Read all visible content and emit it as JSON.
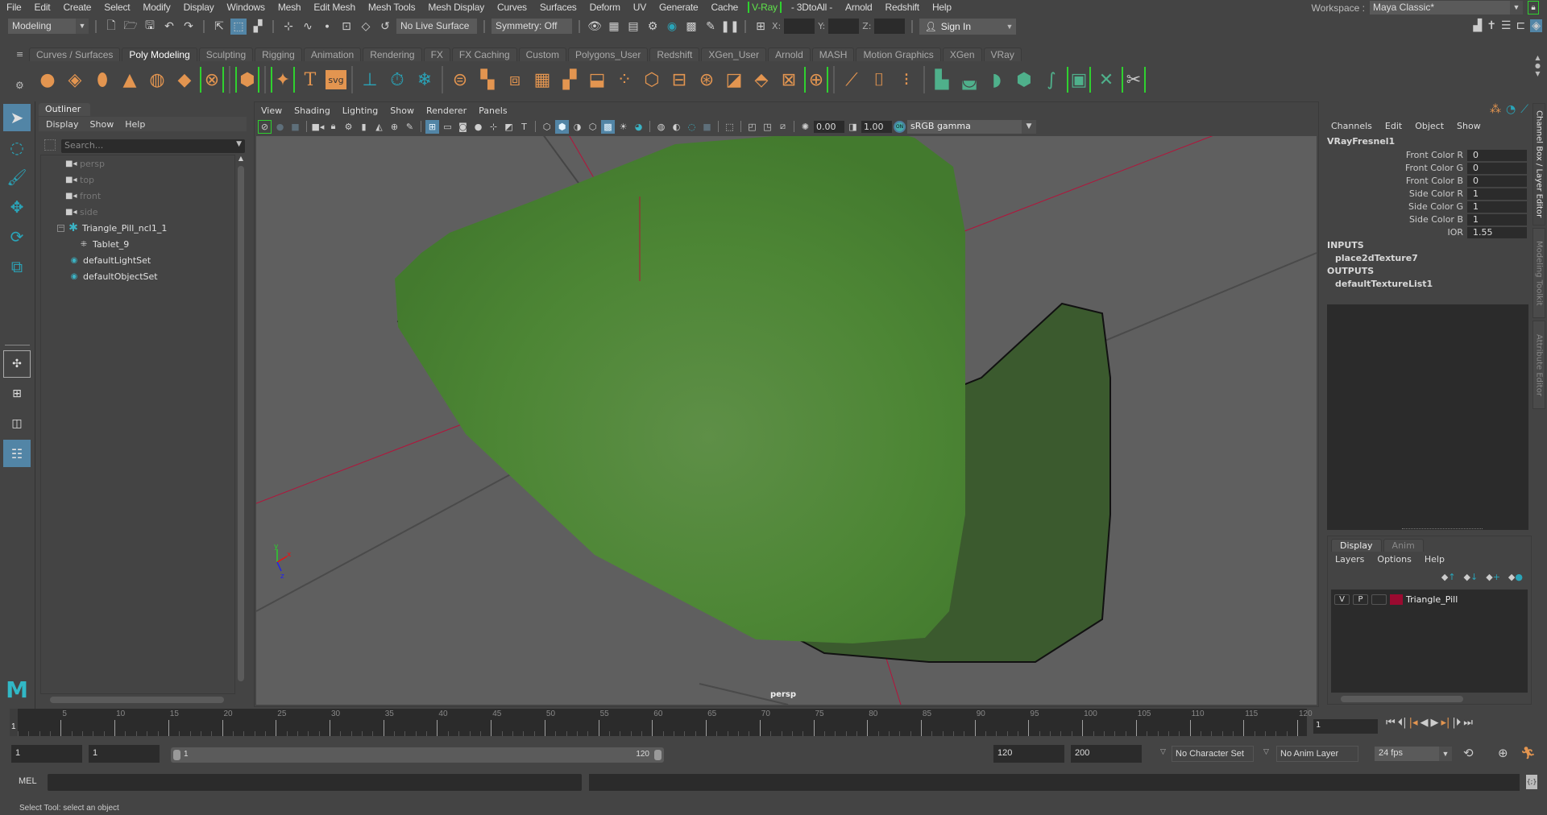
{
  "menubar": {
    "items": [
      "File",
      "Edit",
      "Create",
      "Select",
      "Modify",
      "Display",
      "Windows",
      "Mesh",
      "Edit Mesh",
      "Mesh Tools",
      "Mesh Display",
      "Curves",
      "Surfaces",
      "Deform",
      "UV",
      "Generate",
      "Cache",
      "V-Ray",
      "- 3DtoAll -",
      "Arnold",
      "Redshift",
      "Help"
    ],
    "workspace_label": "Workspace :",
    "workspace_value": "Maya Classic*"
  },
  "statusline": {
    "mode": "Modeling",
    "live_surface": "No Live Surface",
    "symmetry": "Symmetry: Off",
    "x_label": "X:",
    "y_label": "Y:",
    "z_label": "Z:",
    "sign_in": "Sign In"
  },
  "shelf": {
    "tabs": [
      "Curves / Surfaces",
      "Poly Modeling",
      "Sculpting",
      "Rigging",
      "Animation",
      "Rendering",
      "FX",
      "FX Caching",
      "Custom",
      "Polygons_User",
      "Redshift",
      "XGen_User",
      "Arnold",
      "MASH",
      "Motion Graphics",
      "XGen",
      "VRay"
    ],
    "active_tab": "Poly Modeling"
  },
  "outliner": {
    "title": "Outliner",
    "menus": [
      "Display",
      "Show",
      "Help"
    ],
    "search_placeholder": "Search...",
    "items": [
      {
        "label": "persp",
        "icon": "camera-icon",
        "dim": true
      },
      {
        "label": "top",
        "icon": "camera-icon",
        "dim": true
      },
      {
        "label": "front",
        "icon": "camera-icon",
        "dim": true
      },
      {
        "label": "side",
        "icon": "camera-icon",
        "dim": true
      },
      {
        "label": "Triangle_Pill_ncl1_1",
        "icon": "group-icon",
        "dim": false
      },
      {
        "label": "Tablet_9",
        "icon": "mesh-icon",
        "dim": false
      },
      {
        "label": "defaultLightSet",
        "icon": "set-icon",
        "dim": false
      },
      {
        "label": "defaultObjectSet",
        "icon": "set-icon",
        "dim": false
      }
    ]
  },
  "viewport": {
    "menus": [
      "View",
      "Shading",
      "Lighting",
      "Show",
      "Renderer",
      "Panels"
    ],
    "exposure": "0.00",
    "gamma": "1.00",
    "color_management": "sRGB gamma",
    "camera_label": "persp",
    "axis": {
      "x": "x",
      "y": "y",
      "z": "z"
    },
    "object_color": "#4e8a36"
  },
  "channel_box": {
    "menus": [
      "Channels",
      "Edit",
      "Object",
      "Show"
    ],
    "node": "VRayFresnel1",
    "attributes": [
      {
        "name": "Front Color R",
        "value": "0"
      },
      {
        "name": "Front Color G",
        "value": "0"
      },
      {
        "name": "Front Color B",
        "value": "0"
      },
      {
        "name": "Side Color R",
        "value": "1"
      },
      {
        "name": "Side Color G",
        "value": "1"
      },
      {
        "name": "Side Color B",
        "value": "1"
      },
      {
        "name": "IOR",
        "value": "1.55"
      }
    ],
    "inputs_label": "INPUTS",
    "inputs": [
      "place2dTexture7"
    ],
    "outputs_label": "OUTPUTS",
    "outputs": [
      "defaultTextureList1"
    ]
  },
  "side_tabs": [
    "Channel Box / Layer Editor",
    "Modeling Toolkit",
    "Attribute Editor"
  ],
  "layer_editor": {
    "tabs": [
      "Display",
      "Anim"
    ],
    "active_tab": "Display",
    "menus": [
      "Layers",
      "Options",
      "Help"
    ],
    "layers": [
      {
        "visible": "V",
        "playback": "P",
        "type": "",
        "color": "#9b0a30",
        "name": "Triangle_Pill"
      }
    ]
  },
  "timeline": {
    "start": 1,
    "end": 120,
    "ticks": [
      "5",
      "10",
      "15",
      "20",
      "25",
      "30",
      "35",
      "40",
      "45",
      "50",
      "55",
      "60",
      "65",
      "70",
      "75",
      "80",
      "85",
      "90",
      "95",
      "100",
      "105",
      "110",
      "115",
      "120"
    ],
    "current_frame": "1",
    "current_frame_field": "1"
  },
  "range": {
    "anim_start": "1",
    "playback_start": "1",
    "slider_start": "1",
    "slider_end": "120",
    "playback_end": "120",
    "anim_end": "200",
    "character_set": "No Character Set",
    "anim_layer": "No Anim Layer",
    "fps": "24 fps"
  },
  "command_line": {
    "language": "MEL"
  },
  "help_line": "Select Tool: select an object"
}
